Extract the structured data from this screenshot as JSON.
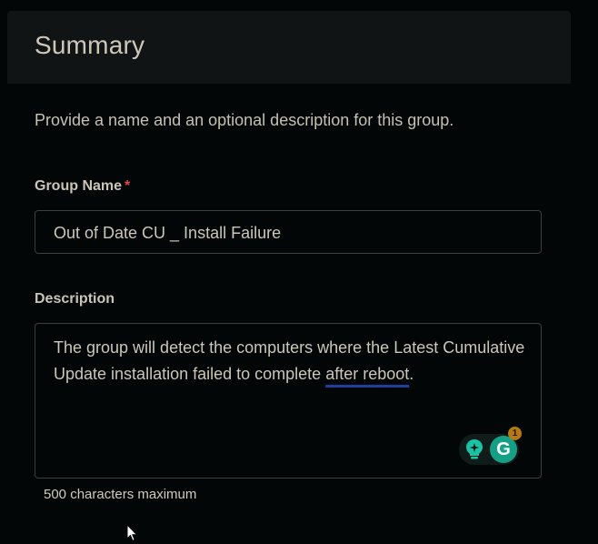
{
  "summary": {
    "title": "Summary",
    "intro": "Provide a name and an optional description for this group."
  },
  "group_name": {
    "label": "Group Name",
    "required_marker": "*",
    "value": "Out of Date CU _ Install Failure"
  },
  "description": {
    "label": "Description",
    "text_part1": "The group will detect the computers where the Latest Cumulative Update installation failed to complete ",
    "text_part2": "after reboot",
    "text_part3": ".",
    "hint": "500 characters maximum"
  },
  "grammarly": {
    "badge_count": "1",
    "logo_letter": "G",
    "icons": [
      "lightbulb-sparkle-icon",
      "grammarly-g-icon"
    ]
  },
  "cursor": {
    "icon": "mouse-pointer-icon"
  },
  "colors": {
    "background": "#020607",
    "panel": "#111415",
    "required": "#e2474a",
    "grammarly_green": "#15a086",
    "squiggle": "#1f3f9e"
  }
}
